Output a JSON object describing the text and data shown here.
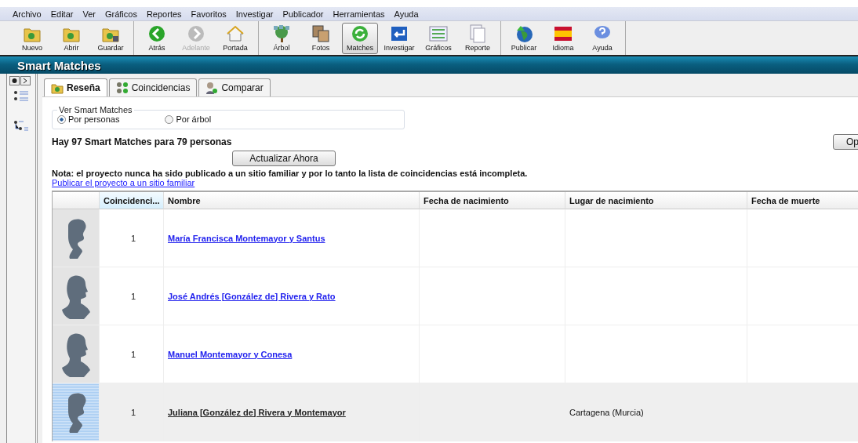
{
  "menu": [
    "Archivo",
    "Editar",
    "Ver",
    "Gráficos",
    "Reportes",
    "Favoritos",
    "Investigar",
    "Publicador",
    "Herramientas",
    "Ayuda"
  ],
  "toolbar": [
    [
      {
        "label": "Nuevo",
        "kind": "new",
        "disabled": false,
        "selected": false
      },
      {
        "label": "Abrir",
        "kind": "open",
        "disabled": false,
        "selected": false
      },
      {
        "label": "Guardar",
        "kind": "save",
        "disabled": false,
        "selected": false
      }
    ],
    [
      {
        "label": "Atrás",
        "kind": "back",
        "disabled": false,
        "selected": false
      },
      {
        "label": "Adelante",
        "kind": "forward",
        "disabled": true,
        "selected": false
      },
      {
        "label": "Portada",
        "kind": "home",
        "disabled": false,
        "selected": false
      }
    ],
    [
      {
        "label": "Árbol",
        "kind": "tree",
        "disabled": false,
        "selected": false
      },
      {
        "label": "Fotos",
        "kind": "photos",
        "disabled": false,
        "selected": false
      },
      {
        "label": "Matches",
        "kind": "refresh",
        "disabled": false,
        "selected": true
      },
      {
        "label": "Investigar",
        "kind": "research",
        "disabled": false,
        "selected": false
      },
      {
        "label": "Gráficos",
        "kind": "chart",
        "disabled": false,
        "selected": false
      },
      {
        "label": "Reporte",
        "kind": "report",
        "disabled": false,
        "selected": false
      }
    ],
    [
      {
        "label": "Publicar",
        "kind": "globe",
        "disabled": false,
        "selected": false
      },
      {
        "label": "Idioma",
        "kind": "flag",
        "disabled": false,
        "selected": false
      },
      {
        "label": "Ayuda",
        "kind": "help",
        "disabled": false,
        "selected": false
      }
    ]
  ],
  "title": "Smart Matches",
  "tabs": [
    {
      "label": "Reseña",
      "kind": "summary",
      "selected": true
    },
    {
      "label": "Coincidencias",
      "kind": "matches",
      "selected": false
    },
    {
      "label": "Comparar",
      "kind": "compare",
      "selected": false
    }
  ],
  "view_group": {
    "title": "Ver Smart Matches",
    "options": [
      {
        "label": "Por personas",
        "selected": true
      },
      {
        "label": "Por árbol",
        "selected": false
      }
    ]
  },
  "summary": "Hay 97 Smart Matches para 79 personas",
  "options_button": "Op",
  "update_button": "Actualizar Ahora",
  "note": "Nota: el proyecto nunca ha sido publicado a un sitio familiar y por lo tanto la lista de coincidencias está incompleta.",
  "publish_link": "Publicar el proyecto a un sitio familiar",
  "table": {
    "columns": [
      "Coincidenci...",
      "Nombre",
      "Fecha de nacimiento",
      "Lugar de nacimiento",
      "Fecha de muerte"
    ],
    "rows": [
      {
        "kind": "female",
        "matches": "1",
        "name": "María Francisca Montemayor y Santus",
        "birth_date": "",
        "birth_place": "",
        "death_date": "",
        "selected": false
      },
      {
        "kind": "male",
        "matches": "1",
        "name": "José Andrés [González de] Rivera y Rato",
        "birth_date": "",
        "birth_place": "",
        "death_date": "",
        "selected": false
      },
      {
        "kind": "male",
        "matches": "1",
        "name": "Manuel Montemayor y Conesa",
        "birth_date": "",
        "birth_place": "",
        "death_date": "",
        "selected": false
      },
      {
        "kind": "female",
        "matches": "1",
        "name": "Juliana [González de] Rivera y Montemayor",
        "birth_date": "",
        "birth_place": "Cartagena (Murcia)",
        "death_date": "",
        "selected": true
      }
    ]
  }
}
